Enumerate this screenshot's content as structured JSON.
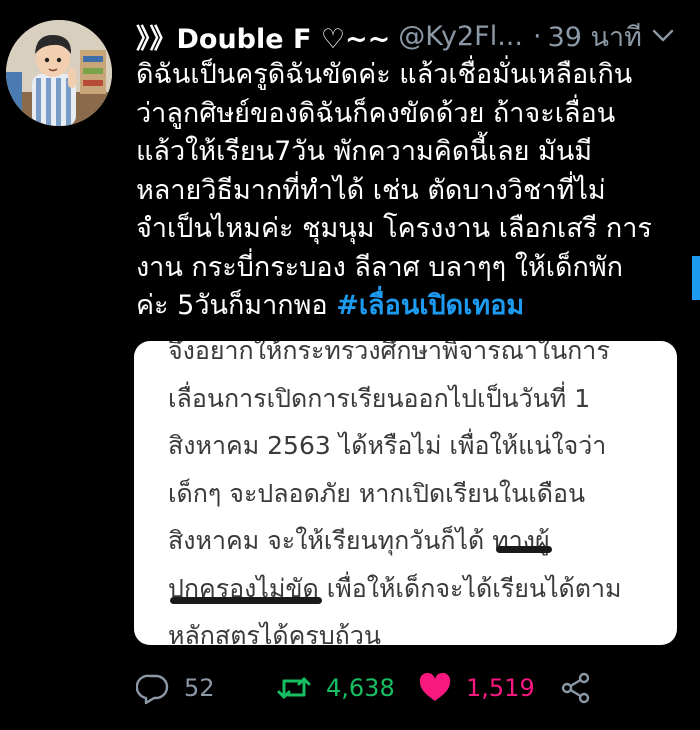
{
  "tweet": {
    "display_name": "》》Double F ♡~~",
    "handle": "@Ky2Fl...",
    "separator": "·",
    "time": "39 นาที",
    "text_lines": [
      "ดิฉันเป็นครูดิฉันขัดค่ะ แล้วเชื่อมั่นเหลือเกิน",
      "ว่าลูกศิษย์ของดิฉันก็คงขัดด้วย ถ้าจะเลื่อน",
      "แล้วให้เรียน7วัน พักความคิดนี้เลย มันมี",
      "หลายวิธีมากที่ทำได้ เช่น ตัดบางวิชาที่ไม่",
      "จำเป็นไหมค่ะ ชุมนุม โครงงาน เลือกเสรี การ",
      "งาน กระบี่กระบอง ลีลาศ บลาๆๆ ให้เด็กพัก"
    ],
    "last_line_text": "ค่ะ 5วันก็มากพอ ",
    "hashtag": "#เลื่อนเปิดเทอม"
  },
  "media": {
    "lines": [
      "จึงอยากให้กระทรวงศึกษาพิจารณาในการ",
      "เลื่อนการเปิดการเรียนออกไปเป็นวันที่ 1",
      "สิงหาคม 2563 ได้หรือไม่ เพื่อให้แน่ใจว่า",
      "เด็กๆ จะปลอดภัย หากเปิดเรียนในเดือน",
      "สิงหาคม จะให้เรียนทุกวันก็ได้ ทางผู้",
      "ปกครองไม่ขัด เพื่อให้เด็กจะได้เรียนได้ตาม",
      "หลักสูตรได้ครบถ้วน"
    ]
  },
  "actions": {
    "reply_count": "52",
    "retweet_count": "4,638",
    "like_count": "1,519"
  },
  "icons": {
    "reply": "reply-icon",
    "retweet": "retweet-icon",
    "like": "heart-icon",
    "share": "share-icon",
    "more": "chevron-down-icon"
  },
  "colors": {
    "background": "#000000",
    "hashtag": "#1d9bf0",
    "retweet": "#17bf63",
    "like": "#f91880",
    "muted": "#8b98a5"
  }
}
